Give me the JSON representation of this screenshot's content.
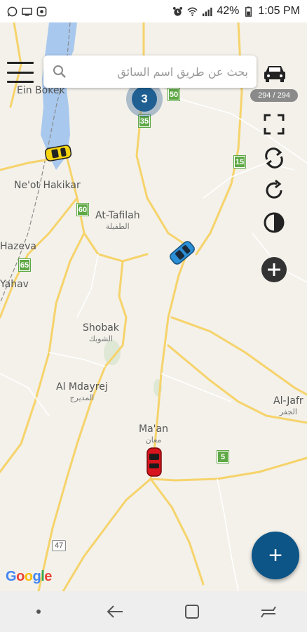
{
  "status_bar": {
    "battery": "42%",
    "time": "1:05 PM"
  },
  "search": {
    "placeholder": "بحث عن طريق اسم السائق"
  },
  "cluster": {
    "count": "3"
  },
  "vehicle_count": "294 / 294",
  "places": [
    {
      "name": "Ein Bokek",
      "arabic": ""
    },
    {
      "name": "Ne'ot Hakikar",
      "arabic": ""
    },
    {
      "name": "At-Tafilah",
      "arabic": "الطفيلة"
    },
    {
      "name": "Hazeva",
      "arabic": ""
    },
    {
      "name": "Yahav",
      "arabic": ""
    },
    {
      "name": "Shobak",
      "arabic": "الشوبك"
    },
    {
      "name": "Al Mdayrej",
      "arabic": "المديرج"
    },
    {
      "name": "Ma'an",
      "arabic": "معان"
    },
    {
      "name": "Al-Jafr",
      "arabic": "الجفر"
    }
  ],
  "road_shields": [
    "50",
    "35",
    "15",
    "60",
    "65",
    "5",
    "47"
  ],
  "google": {
    "letters": [
      "G",
      "o",
      "o",
      "g",
      "l",
      "e"
    ],
    "colors": [
      "#4285F4",
      "#EA4335",
      "#FBBC05",
      "#4285F4",
      "#34A853",
      "#EA4335"
    ]
  },
  "fab_label": "+",
  "colors": {
    "accent": "#0d5487",
    "cluster": "#1f5f92",
    "road": "#f6d36b",
    "car_yellow": "#f5d40f",
    "car_blue": "#2a8fd6",
    "car_red": "#d8141c"
  }
}
